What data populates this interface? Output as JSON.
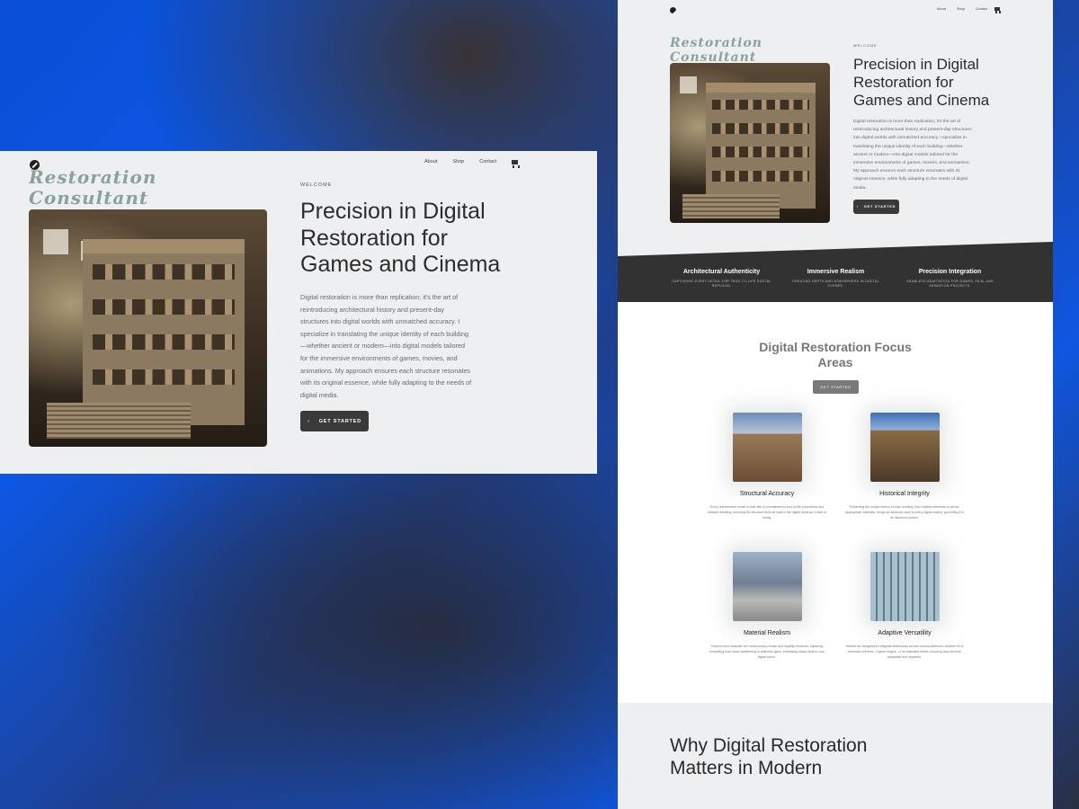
{
  "brand": {
    "name": "Restoration\nConsultant"
  },
  "nav": {
    "about": "About",
    "shop": "Shop",
    "contact": "Contact"
  },
  "hero": {
    "eyebrow": "WELCOME",
    "title": "Precision in Digital Restoration for Games and Cinema",
    "body": "Digital restoration is more than replication; it's the art of reintroducing architectural history and present-day structures into digital worlds with unmatched accuracy. I specialize in translating the unique identity of each building—whether ancient or modern—into digital models tailored for the immersive environments of games, movies, and animations. My approach ensures each structure resonates with its original essence, while fully adapting to the needs of digital media.",
    "cta": "GET STARTED"
  },
  "features": [
    {
      "title": "Architectural Authenticity",
      "subtitle": "CAPTURING EVERY DETAIL FOR TRUE-TO-LIFE DIGITAL REPLICAS."
    },
    {
      "title": "Immersive Realism",
      "subtitle": "CREATING DEPTH AND ATMOSPHERE IN DIGITAL SCENES."
    },
    {
      "title": "Precision Integration",
      "subtitle": "SEAMLESS ADAPTATION FOR GAMES, FILM, AND ANIMATION PROJECTS."
    }
  ],
  "focus": {
    "title": "Digital Restoration Focus Areas",
    "cta": "GET STARTED",
    "cards": [
      {
        "title": "Structural Accuracy",
        "desc": "Every architectural model is built with a commitment to true-to-life proportions and intricate detailing, ensuring the structure feels as solid in the digital world as it does in reality."
      },
      {
        "title": "Historical Integrity",
        "desc": "Preserving the unique history of each building, from stylistic elements to period-appropriate materials, brings an authentic layer to every digital replica, grounding it in its historical context."
      },
      {
        "title": "Material Realism",
        "desc": "Textures and materials are meticulously chosen and digitally rendered, capturing everything from stone weathering to reflective glass, enhancing visual depth in any digital scene."
      },
      {
        "title": "Adaptive Versatility",
        "desc": "Models are designed to integrate seamlessly across various platforms, whether it's a cinematic universe, a game engine, or an animated series, ensuring they are both adaptable and impactful."
      }
    ]
  },
  "why": {
    "title": "Why Digital Restoration Matters in Modern"
  },
  "colors": {
    "accent": "#8aa39a",
    "dark": "#323232",
    "panel": "#eeeff1"
  },
  "icons": {
    "logo": "badge-logo-icon",
    "cart": "cart-icon",
    "chevron": "chevron-right-icon"
  }
}
